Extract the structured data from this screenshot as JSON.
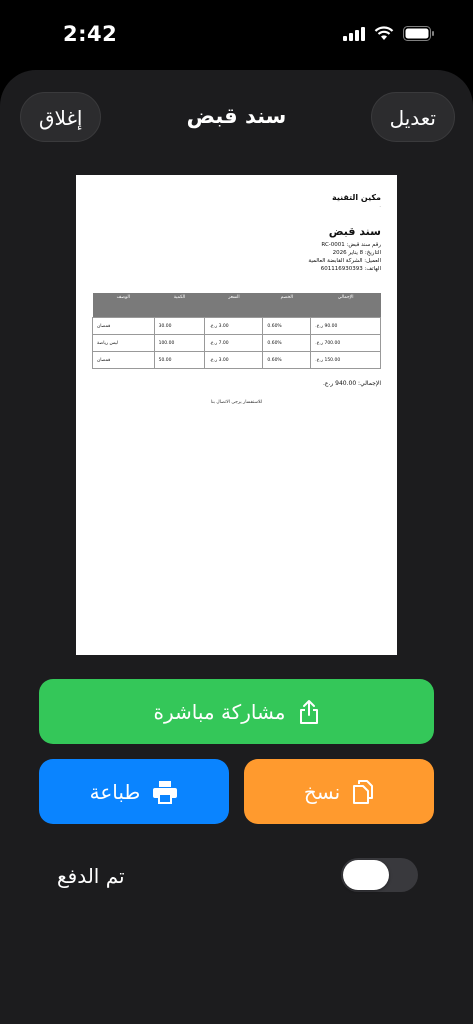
{
  "status": {
    "time": "2:42"
  },
  "header": {
    "title": "سند قبض",
    "close_label": "إغلاق",
    "edit_label": "تعديل"
  },
  "receipt": {
    "company": "مكين التقنية",
    "company_sub": "-",
    "title": "سند قبض",
    "meta_lines": [
      "رقم سند قبض: RC-0001",
      "التاريخ: 8 يناير 2026",
      "العميل: الشركة القابضة العالمية",
      "الهاتف: 601116930393"
    ],
    "columns": [
      "الإجمالي",
      "الخصم",
      "السعر",
      "الكمية",
      "الوصف"
    ],
    "rows": [
      [
        "90.00 ر.ع.",
        "0.60%",
        "3.00 ر.ع.",
        "30.00",
        "قمصان"
      ],
      [
        "700.00 ر.ع.",
        "0.60%",
        "7.00 ر.ع.",
        "100.00",
        "ليس رياضة"
      ],
      [
        "150.00 ر.ع.",
        "0.60%",
        "3.00 ر.ع.",
        "50.00",
        "قمصان"
      ]
    ],
    "total": "الإجمالي: 940.00 ر.ع.",
    "footer": "للاستفسار يرجى الاتصال بنا"
  },
  "actions": {
    "share": "مشاركة مباشرة",
    "copy": "نسخ",
    "print": "طباعة"
  },
  "paid": {
    "label": "تم الدفع",
    "on": false
  }
}
